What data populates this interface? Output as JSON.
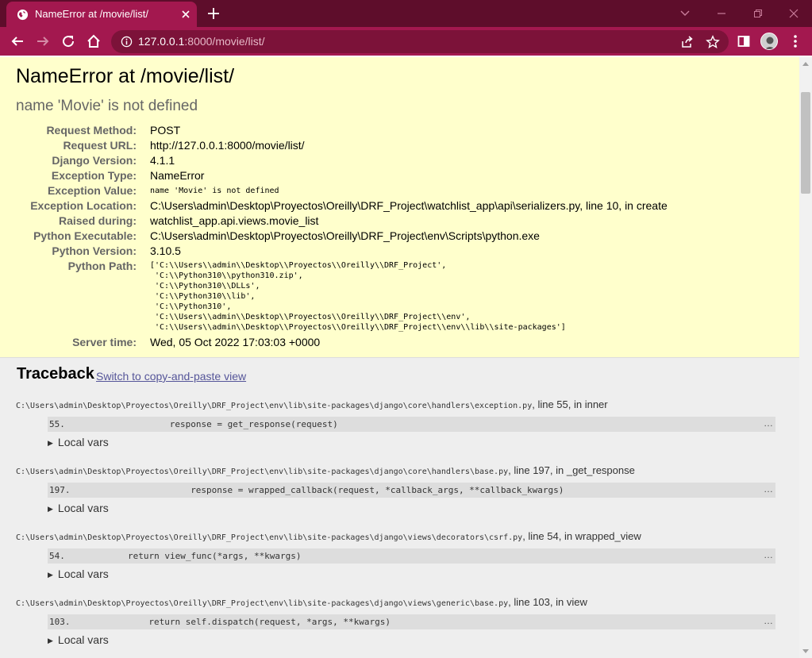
{
  "browser": {
    "tab_title": "NameError at /movie/list/",
    "url_host": "127.0.0.1",
    "url_rest": ":8000/movie/list/",
    "accent": "#a3184f",
    "tabstrip_color": "#5e0d2b"
  },
  "error": {
    "title": "NameError at /movie/list/",
    "message": "name 'Movie' is not defined"
  },
  "meta": [
    {
      "label": "Request Method:",
      "value": "POST"
    },
    {
      "label": "Request URL:",
      "value": "http://127.0.0.1:8000/movie/list/"
    },
    {
      "label": "Django Version:",
      "value": "4.1.1"
    },
    {
      "label": "Exception Type:",
      "value": "NameError"
    },
    {
      "label": "Exception Value:",
      "value": "name 'Movie' is not defined"
    },
    {
      "label": "Exception Location:",
      "value": "C:\\Users\\admin\\Desktop\\Proyectos\\Oreilly\\DRF_Project\\watchlist_app\\api\\serializers.py, line 10, in create"
    },
    {
      "label": "Raised during:",
      "value": "watchlist_app.api.views.movie_list"
    },
    {
      "label": "Python Executable:",
      "value": "C:\\Users\\admin\\Desktop\\Proyectos\\Oreilly\\DRF_Project\\env\\Scripts\\python.exe"
    },
    {
      "label": "Python Version:",
      "value": "3.10.5"
    },
    {
      "label": "Python Path:",
      "value": ""
    },
    {
      "label": "Server time:",
      "value": "Wed, 05 Oct 2022 17:03:03 +0000"
    }
  ],
  "python_path": [
    "['C:\\\\Users\\\\admin\\\\Desktop\\\\Proyectos\\\\Oreilly\\\\DRF_Project',",
    " 'C:\\\\Python310\\\\python310.zip',",
    " 'C:\\\\Python310\\\\DLLs',",
    " 'C:\\\\Python310\\\\lib',",
    " 'C:\\\\Python310',",
    " 'C:\\\\Users\\\\admin\\\\Desktop\\\\Proyectos\\\\Oreilly\\\\DRF_Project\\\\env',",
    " 'C:\\\\Users\\\\admin\\\\Desktop\\\\Proyectos\\\\Oreilly\\\\DRF_Project\\\\env\\\\lib\\\\site-packages']"
  ],
  "traceback": {
    "heading": "Traceback",
    "switch_label": "Switch to copy-and-paste view",
    "local_vars_label": "Local vars",
    "frames": [
      {
        "path": "C:\\Users\\admin\\Desktop\\Proyectos\\Oreilly\\DRF_Project\\env\\lib\\site-packages\\django\\core\\handlers\\exception.py",
        "loc": ", line 55, in inner",
        "line_no": "55.",
        "code": "response = get_response(request)",
        "indent": 16
      },
      {
        "path": "C:\\Users\\admin\\Desktop\\Proyectos\\Oreilly\\DRF_Project\\env\\lib\\site-packages\\django\\core\\handlers\\base.py",
        "loc": ", line 197, in _get_response",
        "line_no": "197.",
        "code": "response = wrapped_callback(request, *callback_args, **callback_kwargs)",
        "indent": 20
      },
      {
        "path": "C:\\Users\\admin\\Desktop\\Proyectos\\Oreilly\\DRF_Project\\env\\lib\\site-packages\\django\\views\\decorators\\csrf.py",
        "loc": ", line 54, in wrapped_view",
        "line_no": "54.",
        "code": "return view_func(*args, **kwargs)",
        "indent": 8
      },
      {
        "path": "C:\\Users\\admin\\Desktop\\Proyectos\\Oreilly\\DRF_Project\\env\\lib\\site-packages\\django\\views\\generic\\base.py",
        "loc": ", line 103, in view",
        "line_no": "103.",
        "code": "return self.dispatch(request, *args, **kwargs)",
        "indent": 12
      }
    ]
  }
}
